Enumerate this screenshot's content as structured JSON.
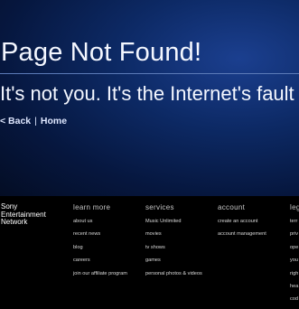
{
  "hero": {
    "title": "Page Not Found!",
    "subtitle": "It's not you. It's the Internet's fault",
    "back_link": "< Back",
    "separator": "|",
    "home_link": "Home"
  },
  "footer": {
    "brand": "Sony Entertainment Network",
    "columns": [
      {
        "heading": "learn more",
        "items": [
          "about us",
          "recent news",
          "blog",
          "careers",
          "join our affiliate program"
        ]
      },
      {
        "heading": "services",
        "items": [
          "Music Unlimited",
          "movies",
          "tv shows",
          "games",
          "personal photos & videos"
        ]
      },
      {
        "heading": "account",
        "items": [
          "create an account",
          "account management"
        ]
      },
      {
        "heading": "leg",
        "items": [
          "terr",
          "priv",
          "ope",
          "you",
          "righ",
          "hea",
          "cod"
        ]
      }
    ]
  }
}
